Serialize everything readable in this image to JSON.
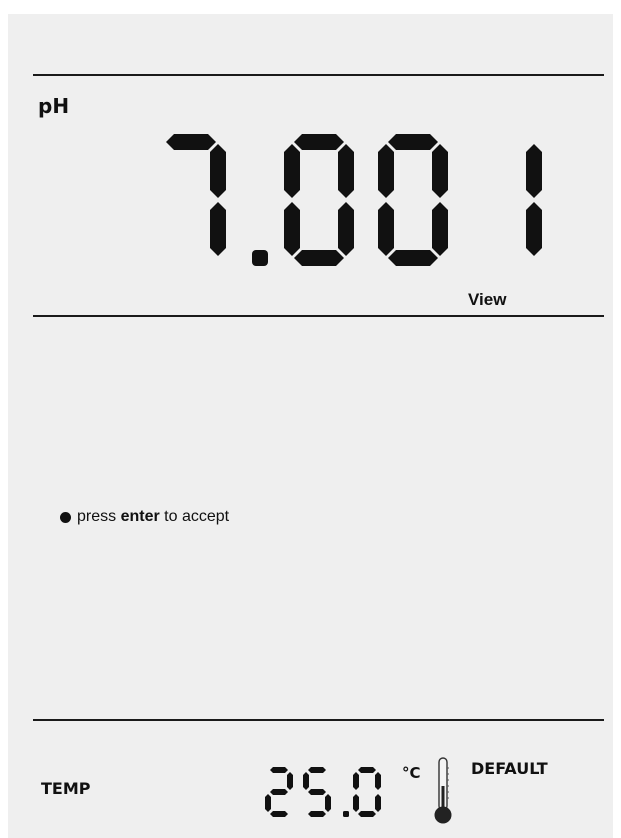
{
  "display": {
    "parameter": "pH",
    "reading": "7.001",
    "mode": "View",
    "prompt": {
      "before": "press",
      "key": "enter",
      "after": "to accept"
    },
    "temperature": {
      "label": "TEMP",
      "value": "25.0",
      "unit": "°C",
      "source": "DEFAULT"
    }
  },
  "icons": {
    "bullet": "bullet-dot-icon",
    "thermometer": "thermometer-icon"
  }
}
